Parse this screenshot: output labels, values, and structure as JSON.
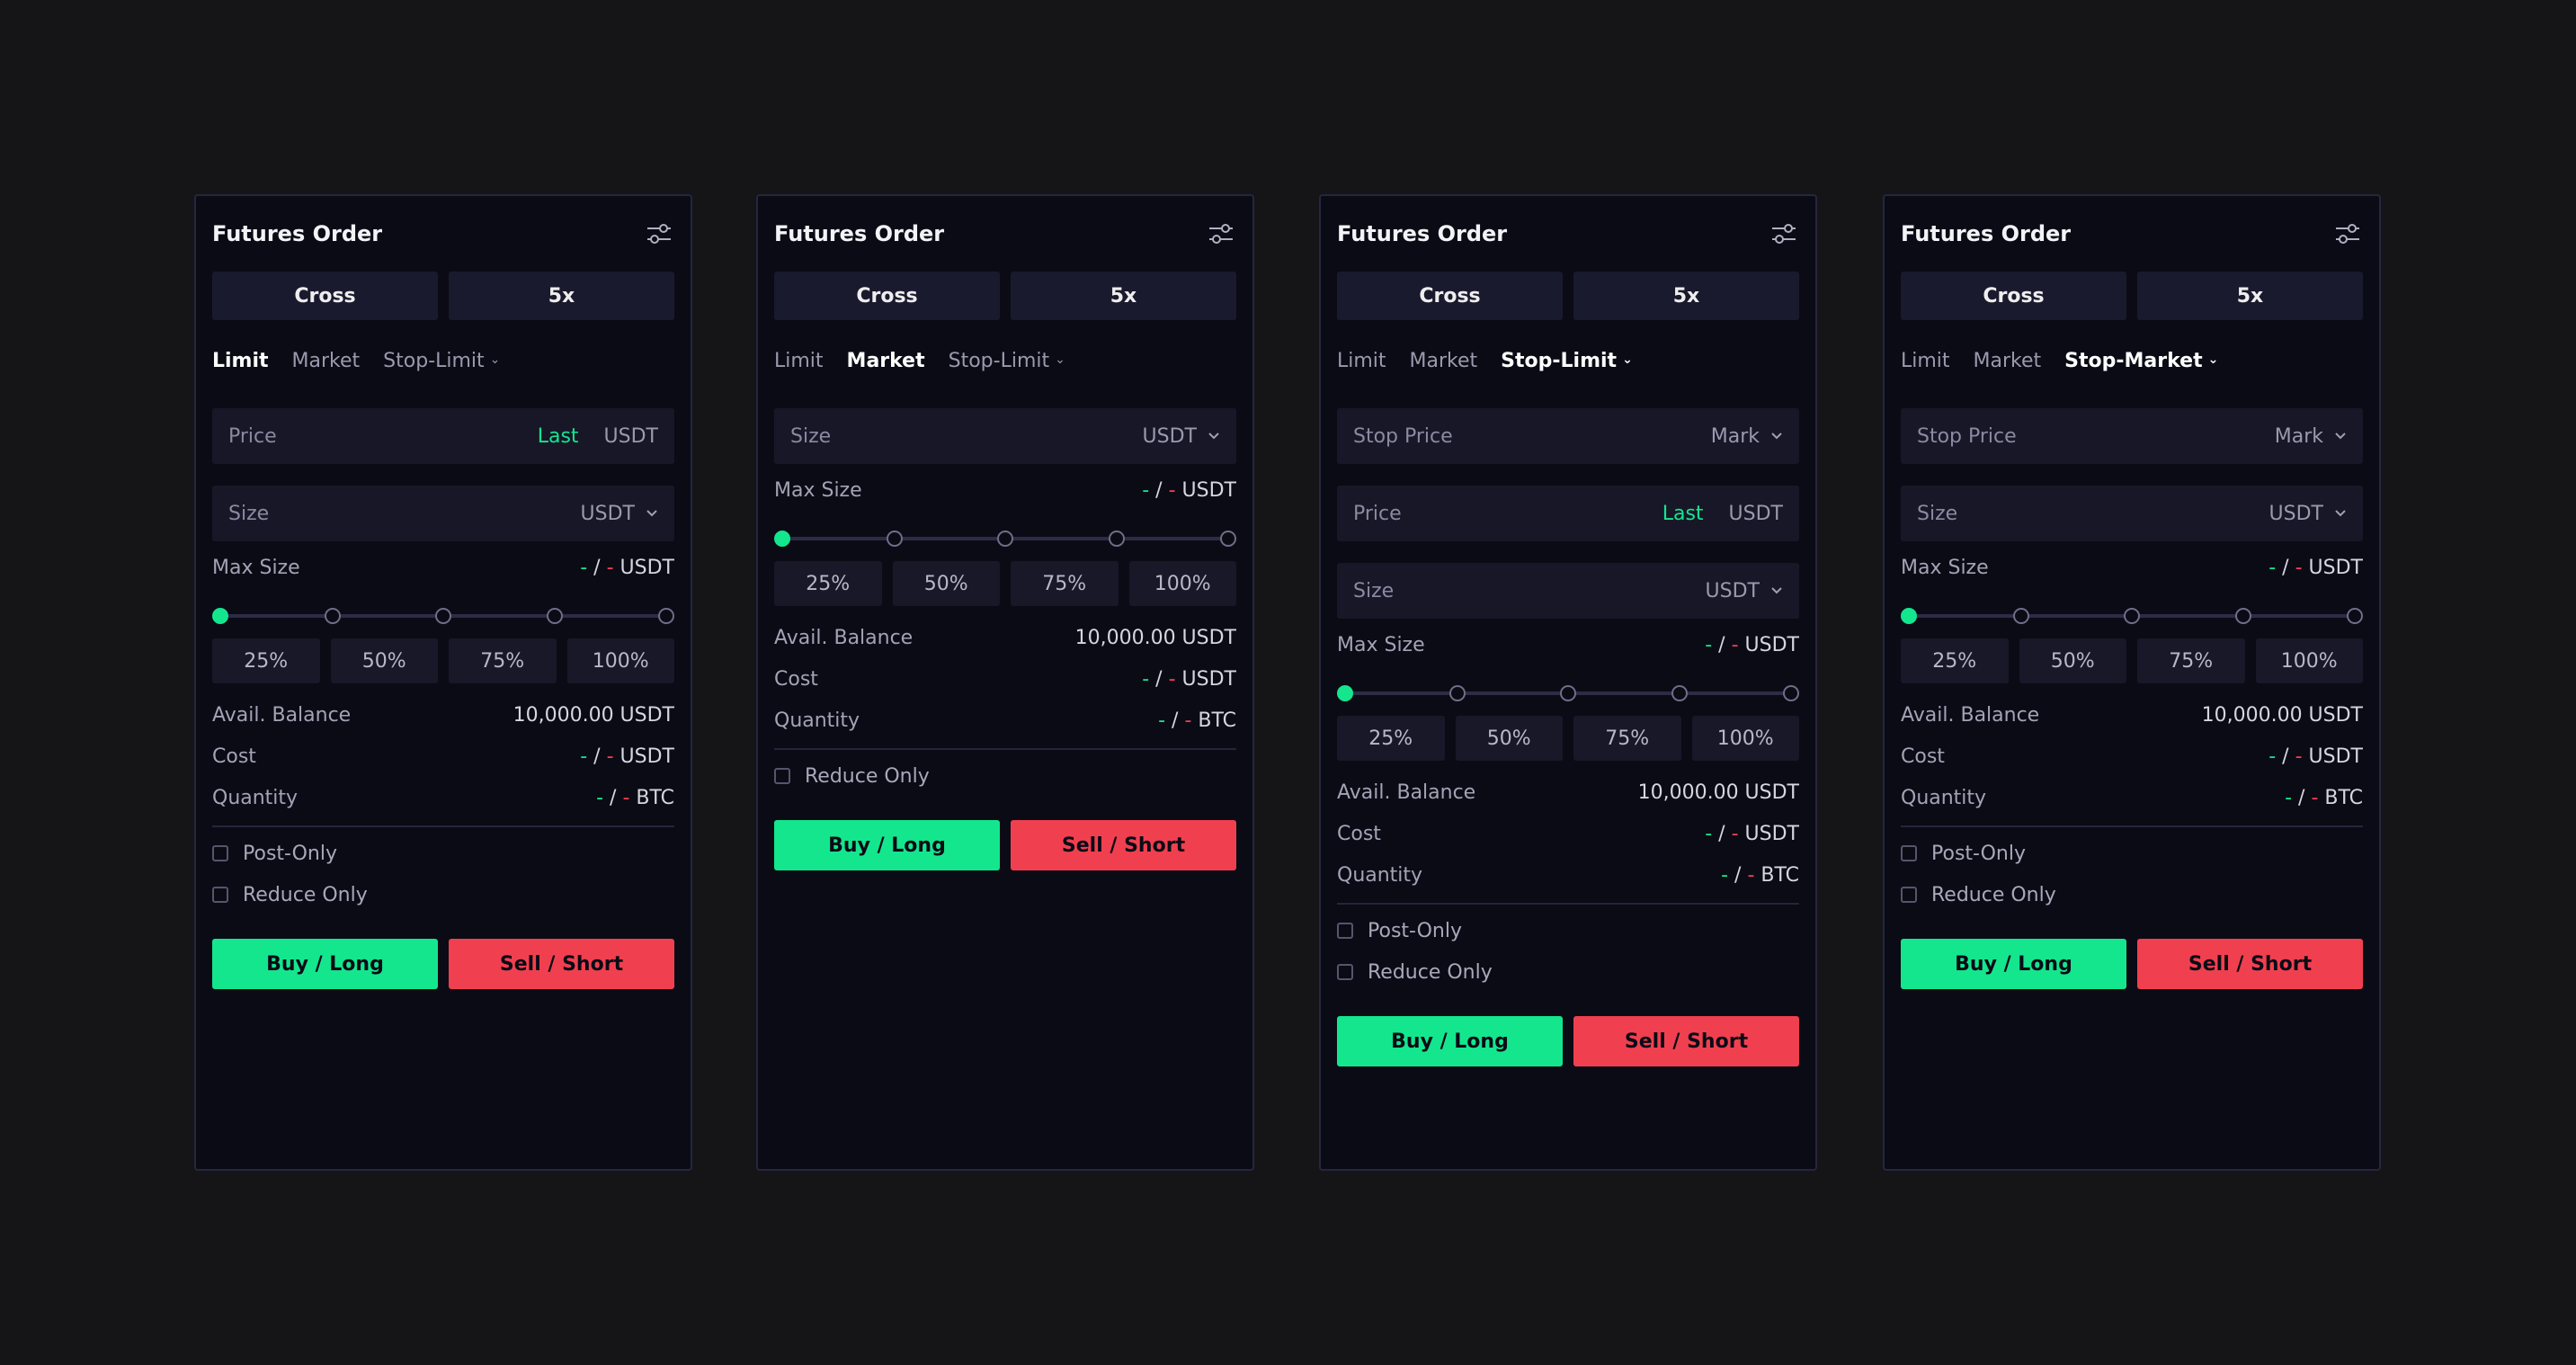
{
  "colors": {
    "background": "#151517",
    "panel": "#0b0b16",
    "accent_green": "#14e68e",
    "accent_red": "#f0404f"
  },
  "panels": [
    {
      "title": "Futures Order",
      "margin_mode": "Cross",
      "leverage": "5x",
      "tabs": [
        "Limit",
        "Market",
        "Stop-Limit"
      ],
      "active_tab": "Limit",
      "price_field": {
        "label": "Price",
        "last": "Last",
        "unit": "USDT"
      },
      "size_field": {
        "label": "Size",
        "unit": "USDT"
      },
      "max_size": {
        "label": "Max Size",
        "unit": "USDT"
      },
      "slider_percent": 0,
      "percent_buttons": [
        "25%",
        "50%",
        "75%",
        "100%"
      ],
      "avail_balance": {
        "label": "Avail. Balance",
        "value": "10,000.00 USDT"
      },
      "cost": {
        "label": "Cost",
        "unit": "USDT"
      },
      "quantity": {
        "label": "Quantity",
        "unit": "BTC"
      },
      "checkboxes": [
        "Post-Only",
        "Reduce Only"
      ],
      "buy_label": "Buy / Long",
      "sell_label": "Sell / Short"
    },
    {
      "title": "Futures Order",
      "margin_mode": "Cross",
      "leverage": "5x",
      "tabs": [
        "Limit",
        "Market",
        "Stop-Limit"
      ],
      "active_tab": "Market",
      "size_field": {
        "label": "Size",
        "unit": "USDT"
      },
      "max_size": {
        "label": "Max Size",
        "unit": "USDT"
      },
      "slider_percent": 0,
      "percent_buttons": [
        "25%",
        "50%",
        "75%",
        "100%"
      ],
      "avail_balance": {
        "label": "Avail. Balance",
        "value": "10,000.00 USDT"
      },
      "cost": {
        "label": "Cost",
        "unit": "USDT"
      },
      "quantity": {
        "label": "Quantity",
        "unit": "BTC"
      },
      "checkboxes": [
        "Reduce Only"
      ],
      "buy_label": "Buy / Long",
      "sell_label": "Sell / Short"
    },
    {
      "title": "Futures Order",
      "margin_mode": "Cross",
      "leverage": "5x",
      "tabs": [
        "Limit",
        "Market",
        "Stop-Limit"
      ],
      "active_tab": "Stop-Limit",
      "stop_price_field": {
        "label": "Stop Price",
        "unit": "Mark"
      },
      "price_field": {
        "label": "Price",
        "last": "Last",
        "unit": "USDT"
      },
      "size_field": {
        "label": "Size",
        "unit": "USDT"
      },
      "max_size": {
        "label": "Max Size",
        "unit": "USDT"
      },
      "slider_percent": 0,
      "percent_buttons": [
        "25%",
        "50%",
        "75%",
        "100%"
      ],
      "avail_balance": {
        "label": "Avail. Balance",
        "value": "10,000.00 USDT"
      },
      "cost": {
        "label": "Cost",
        "unit": "USDT"
      },
      "quantity": {
        "label": "Quantity",
        "unit": "BTC"
      },
      "checkboxes": [
        "Post-Only",
        "Reduce Only"
      ],
      "buy_label": "Buy / Long",
      "sell_label": "Sell / Short"
    },
    {
      "title": "Futures Order",
      "margin_mode": "Cross",
      "leverage": "5x",
      "tabs": [
        "Limit",
        "Market",
        "Stop-Market"
      ],
      "active_tab": "Stop-Market",
      "stop_price_field": {
        "label": "Stop Price",
        "unit": "Mark"
      },
      "size_field": {
        "label": "Size",
        "unit": "USDT"
      },
      "max_size": {
        "label": "Max Size",
        "unit": "USDT"
      },
      "slider_percent": 0,
      "percent_buttons": [
        "25%",
        "50%",
        "75%",
        "100%"
      ],
      "avail_balance": {
        "label": "Avail. Balance",
        "value": "10,000.00 USDT"
      },
      "cost": {
        "label": "Cost",
        "unit": "USDT"
      },
      "quantity": {
        "label": "Quantity",
        "unit": "BTC"
      },
      "checkboxes": [
        "Post-Only",
        "Reduce Only"
      ],
      "buy_label": "Buy / Long",
      "sell_label": "Sell / Short"
    }
  ]
}
